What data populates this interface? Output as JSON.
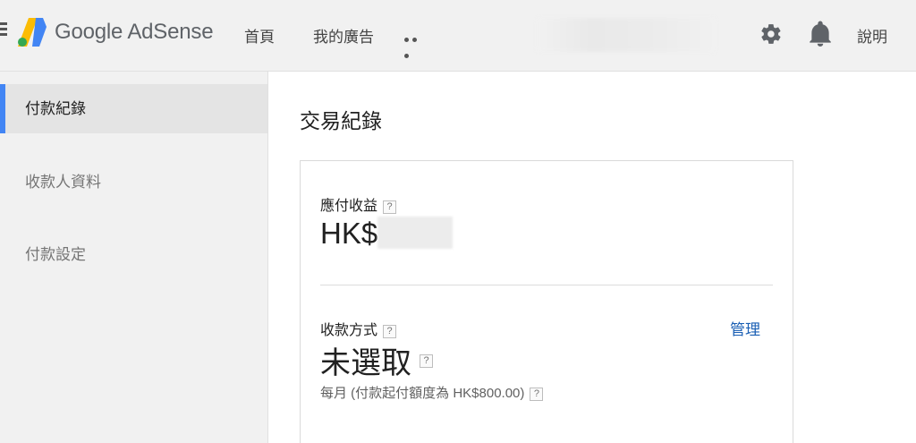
{
  "header": {
    "logo_text": "Google AdSense",
    "nav": {
      "home": "首頁",
      "my_ads": "我的廣告"
    },
    "help": "說明"
  },
  "sidebar": {
    "items": [
      {
        "label": "付款紀錄",
        "active": true
      },
      {
        "label": "收款人資料",
        "active": false
      },
      {
        "label": "付款設定",
        "active": false
      }
    ]
  },
  "main": {
    "title": "交易紀錄",
    "earnings": {
      "label": "應付收益",
      "currency_prefix": "HK$"
    },
    "payment_method": {
      "label": "收款方式",
      "manage": "管理",
      "value": "未選取",
      "threshold": "每月 (付款起付額度為 HK$800.00)"
    },
    "help_glyph": "?"
  },
  "colors": {
    "accent": "#4285f4",
    "link": "#1a5fb4",
    "logo_yellow": "#fbbc04",
    "logo_blue": "#4285f4"
  }
}
